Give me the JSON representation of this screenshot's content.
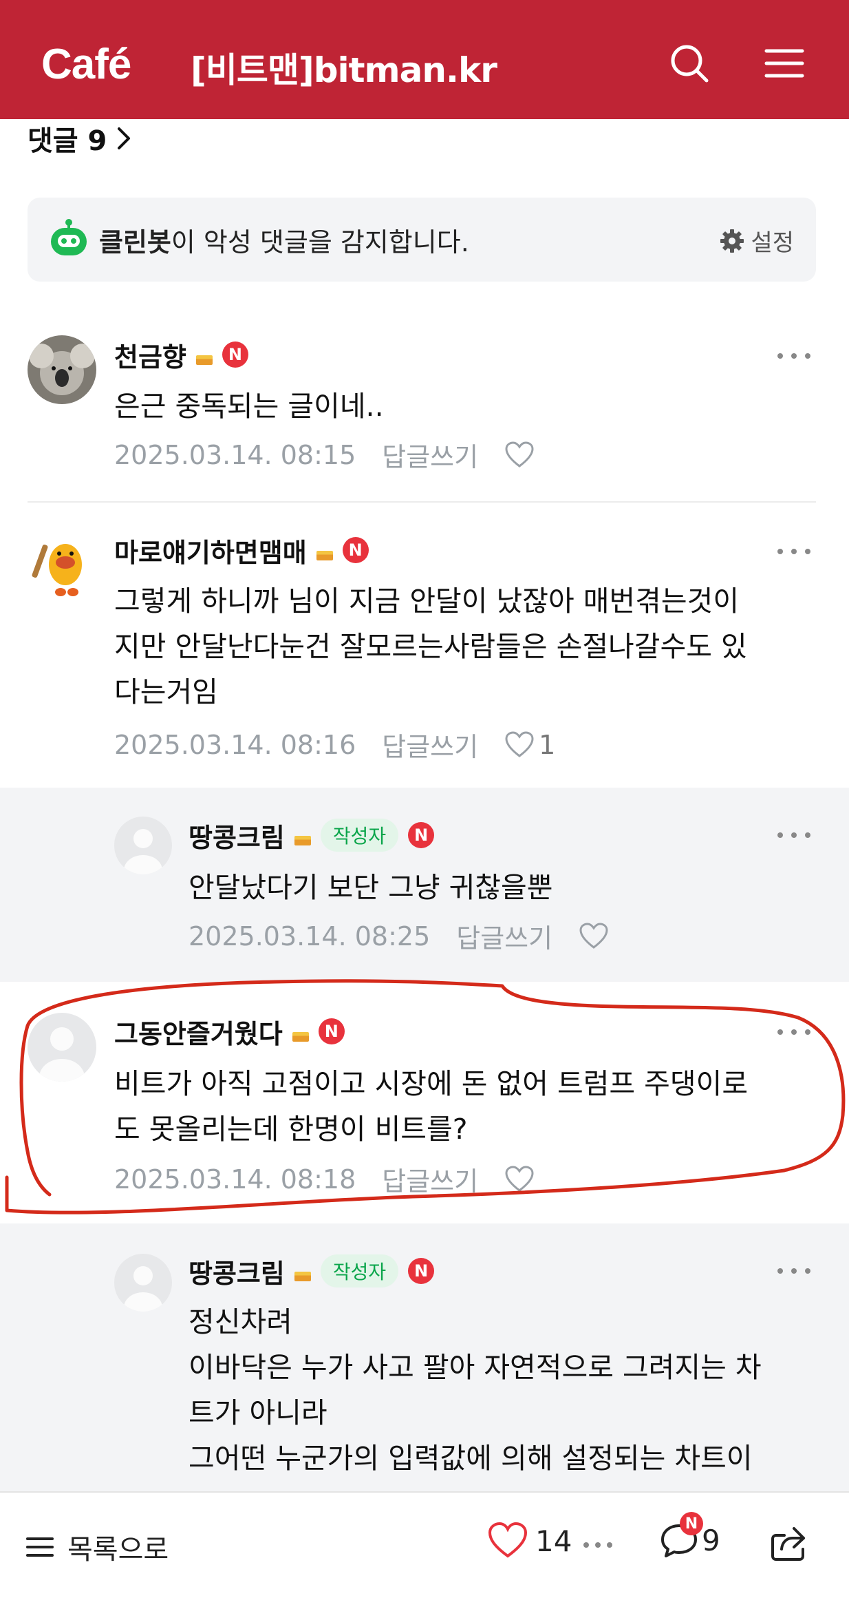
{
  "header": {
    "logo": "Café",
    "cafe_name": "[비트맨]bitman.kr"
  },
  "comments_header": {
    "label": "댓글 9"
  },
  "cleanbot": {
    "bot_name": "클린봇",
    "message": "이 악성 댓글을 감지합니다.",
    "settings_label": "설정"
  },
  "comments": [
    {
      "nickname": "천금향",
      "text_lines": [
        "은근 중독되는 글이네.."
      ],
      "date": "2025.03.14. 08:15",
      "reply_label": "답글쓰기",
      "likes": ""
    },
    {
      "nickname": "마로얘기하면맴매",
      "text_lines": [
        "그렇게 하니까 님이 지금 안달이 났잖아 매번겪는것이",
        "지만 안달난다눈건 잘모르는사람들은 손절나갈수도 있",
        "다는거임"
      ],
      "date": "2025.03.14. 08:16",
      "reply_label": "답글쓰기",
      "likes": "1"
    },
    {
      "nickname": "땅콩크림",
      "author_badge": "작성자",
      "text_lines": [
        "안달났다기 보단 그냥 귀찮을뿐"
      ],
      "date": "2025.03.14. 08:25",
      "reply_label": "답글쓰기",
      "likes": ""
    },
    {
      "nickname": "그동안즐거웠다",
      "text_lines": [
        "비트가 아직 고점이고 시장에 돈 없어 트럼프 주댕이로",
        "도 못올리는데 한명이 비트를?"
      ],
      "date": "2025.03.14. 08:18",
      "reply_label": "답글쓰기",
      "likes": ""
    },
    {
      "nickname": "땅콩크림",
      "author_badge": "작성자",
      "text_lines": [
        "정신차려",
        "이바닥은 누가 사고 팔아 자연적으로 그려지는 차",
        "트가 아니라",
        "그어떤 누군가의 입력값에 의해 설정되는 차트이"
      ]
    }
  ],
  "badge_n": "N",
  "bottom_bar": {
    "list_label": "목록으로",
    "like_count": "14",
    "comment_count": "9"
  },
  "colors": {
    "brand": "#bf2435",
    "annotation": "#d42a1a",
    "author_badge": "#0aa54a"
  }
}
